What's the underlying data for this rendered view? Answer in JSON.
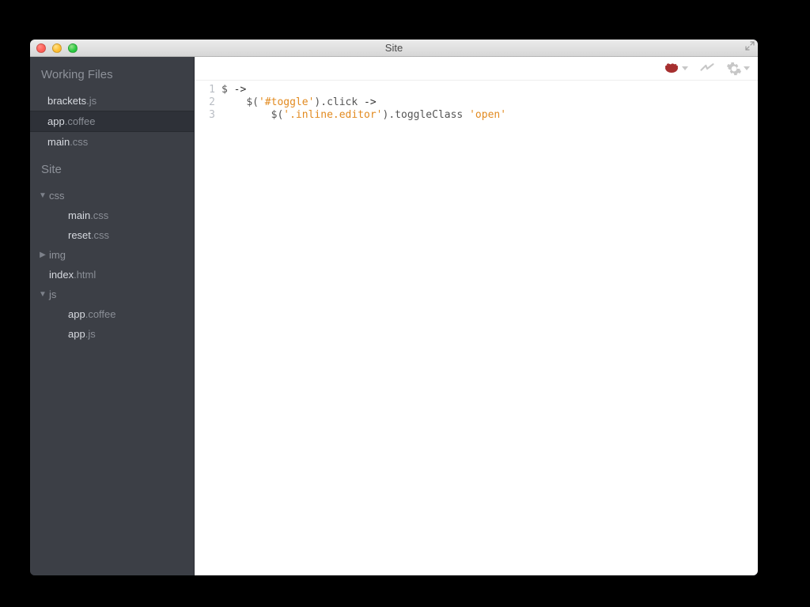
{
  "window": {
    "title": "Site"
  },
  "sidebar": {
    "working_files_header": "Working Files",
    "working_files": [
      {
        "base": "brackets",
        "ext": ".js",
        "selected": false
      },
      {
        "base": "app",
        "ext": ".coffee",
        "selected": true
      },
      {
        "base": "main",
        "ext": ".css",
        "selected": false
      }
    ],
    "project_header": "Site",
    "tree": [
      {
        "type": "folder",
        "name": "css",
        "expanded": true,
        "children": [
          {
            "type": "file",
            "base": "main",
            "ext": ".css"
          },
          {
            "type": "file",
            "base": "reset",
            "ext": ".css"
          }
        ]
      },
      {
        "type": "folder",
        "name": "img",
        "expanded": false,
        "children": []
      },
      {
        "type": "file",
        "base": "index",
        "ext": ".html"
      },
      {
        "type": "folder",
        "name": "js",
        "expanded": true,
        "children": [
          {
            "type": "file",
            "base": "app",
            "ext": ".coffee"
          },
          {
            "type": "file",
            "base": "app",
            "ext": ".js"
          }
        ]
      }
    ]
  },
  "toolbar": {
    "coffee_icon": "coffeescript-icon",
    "bolt_icon": "live-preview-icon",
    "gear_icon": "settings-icon",
    "colors": {
      "coffee": "#a62f2f",
      "muted": "#c7c7c7"
    }
  },
  "editor": {
    "lines": [
      {
        "n": 1,
        "indent": 0,
        "tokens": [
          {
            "t": "$ ",
            "c": "plain"
          },
          {
            "t": "->",
            "c": "keyword"
          }
        ]
      },
      {
        "n": 2,
        "indent": 1,
        "tokens": [
          {
            "t": "$(",
            "c": "plain"
          },
          {
            "t": "'#toggle'",
            "c": "string"
          },
          {
            "t": ").click ",
            "c": "plain"
          },
          {
            "t": "->",
            "c": "keyword"
          }
        ]
      },
      {
        "n": 3,
        "indent": 2,
        "tokens": [
          {
            "t": "$(",
            "c": "plain"
          },
          {
            "t": "'.inline.editor'",
            "c": "string"
          },
          {
            "t": ").toggleClass ",
            "c": "plain"
          },
          {
            "t": "'open'",
            "c": "string"
          }
        ]
      }
    ]
  }
}
